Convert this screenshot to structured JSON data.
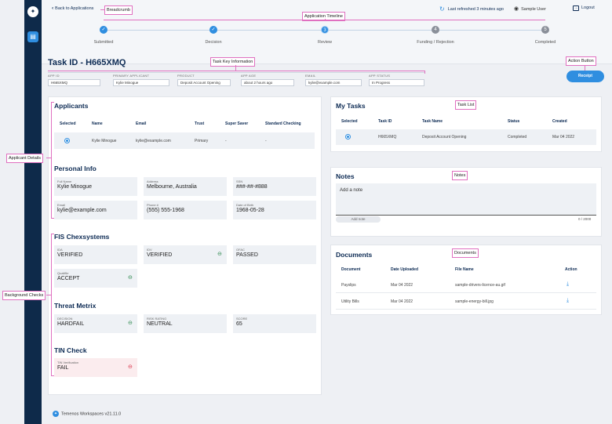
{
  "nav": {
    "back_label": "Back to Applications",
    "refresh_label": "Last refreshed 3 minutes ago",
    "user_name": "Sample User",
    "logout_label": "Logout"
  },
  "timeline": {
    "steps": [
      {
        "label": "Submitted",
        "marker": "✓",
        "state": "done"
      },
      {
        "label": "Decision",
        "marker": "✓",
        "state": "done"
      },
      {
        "label": "Review",
        "marker": "3",
        "state": "current"
      },
      {
        "label": "Funding / Rejection",
        "marker": "4",
        "state": "future"
      },
      {
        "label": "Completed",
        "marker": "5",
        "state": "future"
      }
    ]
  },
  "task": {
    "title": "Task ID - H665XMQ",
    "receipt_label": "Receipt",
    "fields": [
      {
        "label": "APP ID",
        "value": "H665XMQ"
      },
      {
        "label": "PRIMARY APPLICANT",
        "value": "Kylie Minogue"
      },
      {
        "label": "PRODUCT",
        "value": "Deposit Account Opening"
      },
      {
        "label": "APP AGE",
        "value": "about 2 hours ago"
      },
      {
        "label": "EMAIL",
        "value": "kylie@example.com"
      },
      {
        "label": "APP STATUS",
        "value": "In Progress"
      }
    ]
  },
  "applicants": {
    "title": "Applicants",
    "headers": [
      "Selected",
      "Name",
      "Email",
      "Trust",
      "Super Saver",
      "Standard Checking"
    ],
    "row": [
      "Kylie Minogue",
      "kylie@example.com",
      "Primary",
      "-",
      "-"
    ]
  },
  "personal": {
    "title": "Personal Info",
    "fields": [
      {
        "label": "Full Name",
        "value": "Kylie Minogue"
      },
      {
        "label": "Address",
        "value": "Melbourne, Australia"
      },
      {
        "label": "SSN",
        "value": "###-##-#888"
      },
      {
        "label": "Email",
        "value": "kylie@example.com"
      },
      {
        "label": "Phone #",
        "value": "(555) 555-1968"
      },
      {
        "label": "Date of Birth",
        "value": "1968-05-28"
      }
    ]
  },
  "fis": {
    "title": "FIS Chexsystems",
    "fields": [
      {
        "label": "IDA",
        "value": "VERIFIED"
      },
      {
        "label": "IDV",
        "value": "VERIFIED"
      },
      {
        "label": "OFAC",
        "value": "PASSED"
      },
      {
        "label": "Qualifile",
        "value": "ACCEPT"
      }
    ]
  },
  "threat": {
    "title": "Threat Metrix",
    "fields": [
      {
        "label": "DECISION",
        "value": "HARDFAIL"
      },
      {
        "label": "RISK RATING",
        "value": "NEUTRAL"
      },
      {
        "label": "SCORE",
        "value": "65"
      }
    ]
  },
  "tin": {
    "title": "TIN Check",
    "fields": [
      {
        "label": "TIN Verification",
        "value": "FAIL"
      }
    ]
  },
  "tasks": {
    "title": "My Tasks",
    "headers": [
      "Selected",
      "Task ID",
      "Task Name",
      "Status",
      "Created"
    ],
    "row": [
      "H665XMQ",
      "Deposit Account Opening",
      "Completed",
      "Mar 04 2022"
    ]
  },
  "notes": {
    "title": "Notes",
    "placeholder": "Add a note",
    "add_label": "Add note",
    "counter": "0 / 2000"
  },
  "documents": {
    "title": "Documents",
    "headers": [
      "Document",
      "Date Uploaded",
      "File Name",
      "Action"
    ],
    "rows": [
      [
        "Payslips",
        "Mar 04 2022",
        "sample-drivers-licence-au.gif"
      ],
      [
        "Utility Bills",
        "Mar 04 2022",
        "sample-energy-bill.jpg"
      ]
    ]
  },
  "annotations": {
    "breadcrumb": "Breadcrumb",
    "timeline": "Application Timeline",
    "key_info": "Task Key Information",
    "action_button": "Action Button",
    "task_list": "Task List",
    "notes": "Notes",
    "documents": "Documents",
    "applicant_details": "Applicant Details",
    "background_checks": "Background Checks"
  },
  "footer": {
    "text": "Temenos Workspaces  v21.11.0"
  },
  "icons": {
    "refresh": "refresh-icon",
    "user": "user-icon",
    "logout": "logout-icon",
    "link": "link-icon",
    "download": "download-icon"
  },
  "colors": {
    "accent": "#2f8ee0",
    "navy": "#0d2b54",
    "sidebar": "#0e2a4a",
    "annotation": "#e070c0"
  }
}
